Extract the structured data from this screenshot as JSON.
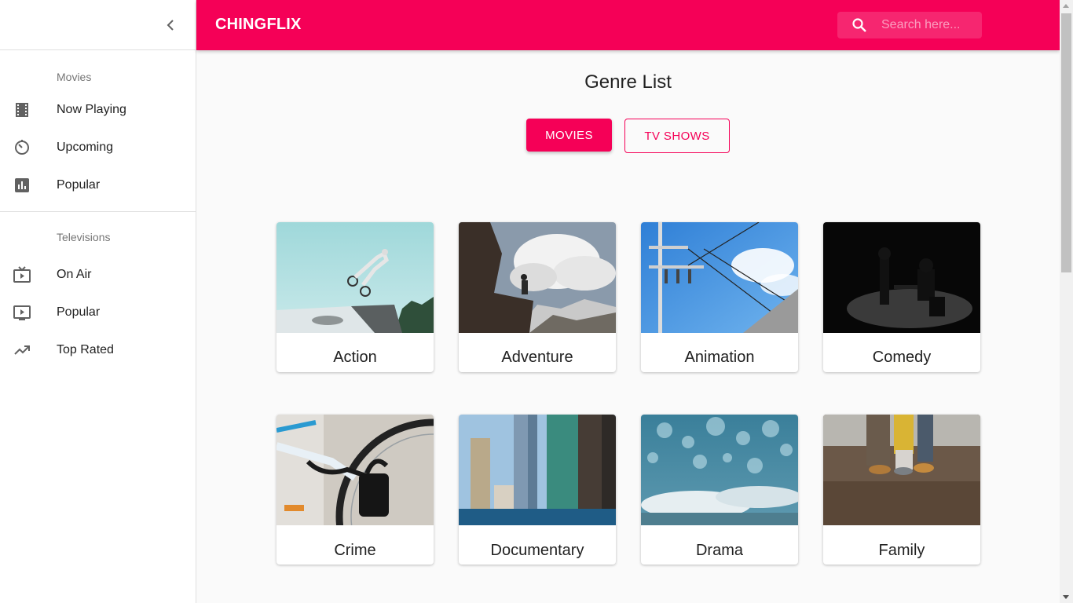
{
  "app": {
    "brand": "CHINGFLIX"
  },
  "search": {
    "placeholder": "Search here..."
  },
  "sidebar": {
    "movies_title": "Movies",
    "movies": [
      {
        "label": "Now Playing",
        "icon": "movie-film-icon"
      },
      {
        "label": "Upcoming",
        "icon": "timer-icon"
      },
      {
        "label": "Popular",
        "icon": "bar-chart-icon"
      }
    ],
    "tv_title": "Televisions",
    "tv": [
      {
        "label": "On Air",
        "icon": "live-tv-icon"
      },
      {
        "label": "Popular",
        "icon": "tv-play-icon"
      },
      {
        "label": "Top Rated",
        "icon": "trending-up-icon"
      }
    ]
  },
  "main": {
    "title": "Genre List",
    "tabs": [
      "MOVIES",
      "TV SHOWS"
    ],
    "active_tab": "MOVIES",
    "genres": [
      {
        "name": "Action"
      },
      {
        "name": "Adventure"
      },
      {
        "name": "Animation"
      },
      {
        "name": "Comedy"
      },
      {
        "name": "Crime"
      },
      {
        "name": "Documentary"
      },
      {
        "name": "Drama"
      },
      {
        "name": "Family"
      }
    ]
  },
  "colors": {
    "accent": "#f50057",
    "sidebar_bg": "#ffffff",
    "page_bg": "#fafafa"
  }
}
